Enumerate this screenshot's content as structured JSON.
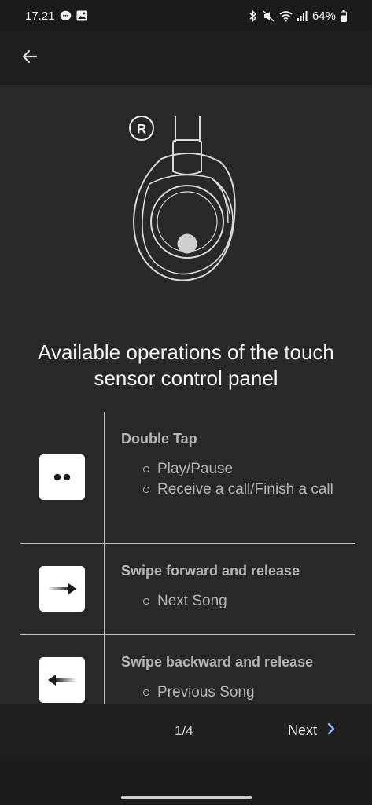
{
  "status_bar": {
    "time": "17.21",
    "battery": "64%",
    "left_icons": [
      "messenger-icon",
      "gallery-icon"
    ],
    "right_icons": [
      "bluetooth-icon",
      "mute-icon",
      "wifi-icon",
      "signal-icon",
      "battery-icon"
    ]
  },
  "app_bar": {
    "back_icon": "arrow-left-icon"
  },
  "illustration": {
    "side_label": "R"
  },
  "panel": {
    "title": "Available operations of the touch sensor control panel"
  },
  "operations": [
    {
      "icon": "double-tap-icon",
      "title": "Double Tap",
      "actions": [
        "Play/Pause",
        "Receive a call/Finish a call"
      ]
    },
    {
      "icon": "swipe-forward-icon",
      "title": "Swipe forward and release",
      "actions": [
        "Next Song"
      ]
    },
    {
      "icon": "swipe-backward-icon",
      "title": "Swipe backward and release",
      "actions": [
        "Previous Song"
      ]
    }
  ],
  "footer": {
    "page_indicator": "1/4",
    "next_label": "Next",
    "next_icon": "chevron-right-icon",
    "accent": "#8fb0ff"
  },
  "colors": {
    "background": "#282828",
    "bar": "#1f1f1f",
    "muted_text": "#b5b5b5"
  }
}
